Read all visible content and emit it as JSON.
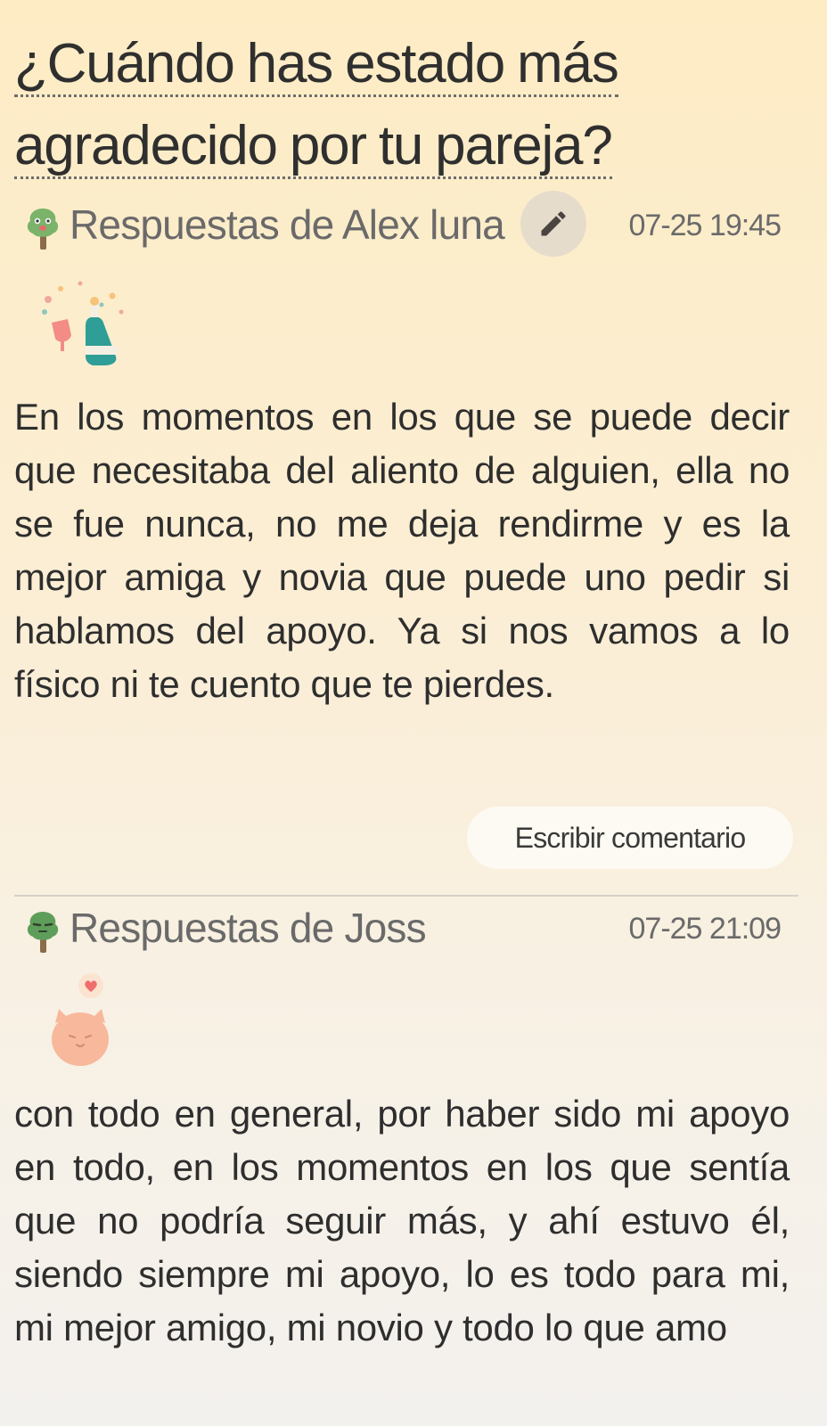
{
  "question": {
    "title_line1": "¿Cuándo has estado más",
    "title_line2": "agradecido por tu pareja?"
  },
  "answers": [
    {
      "author_label": "Respuestas de Alex luna",
      "timestamp": "07-25 19:45",
      "sticker": "champagne-celebration-sticker",
      "text": "En los momentos en los que se puede decir que necesitaba del aliento de alguien, ella no se fue nunca, no me deja rendirme y es la mejor amiga y novia que puede uno pedir si hablamos del apoyo. Ya si nos vamos a lo físico ni te cuento que te pierdes.",
      "comment_button_label": "Escribir comentario",
      "icon": "tree-icon",
      "edit_icon": "pencil-icon"
    },
    {
      "author_label": "Respuestas de Joss",
      "timestamp": "07-25 21:09",
      "sticker": "cat-heart-sticker",
      "text": "con todo en general, por haber sido mi apoyo en todo, en los momentos en los que sentía que no podría seguir más, y ahí estuvo él, siendo siempre mi apoyo, lo es todo para mi, mi mejor amigo, mi novio y todo lo que amo",
      "icon": "tree-icon"
    }
  ],
  "colors": {
    "background_top": "#fdecc4",
    "background_bottom": "#f3f1ee",
    "edit_button_bg": "#e6dccb",
    "tree_green": "#7bb36a"
  }
}
